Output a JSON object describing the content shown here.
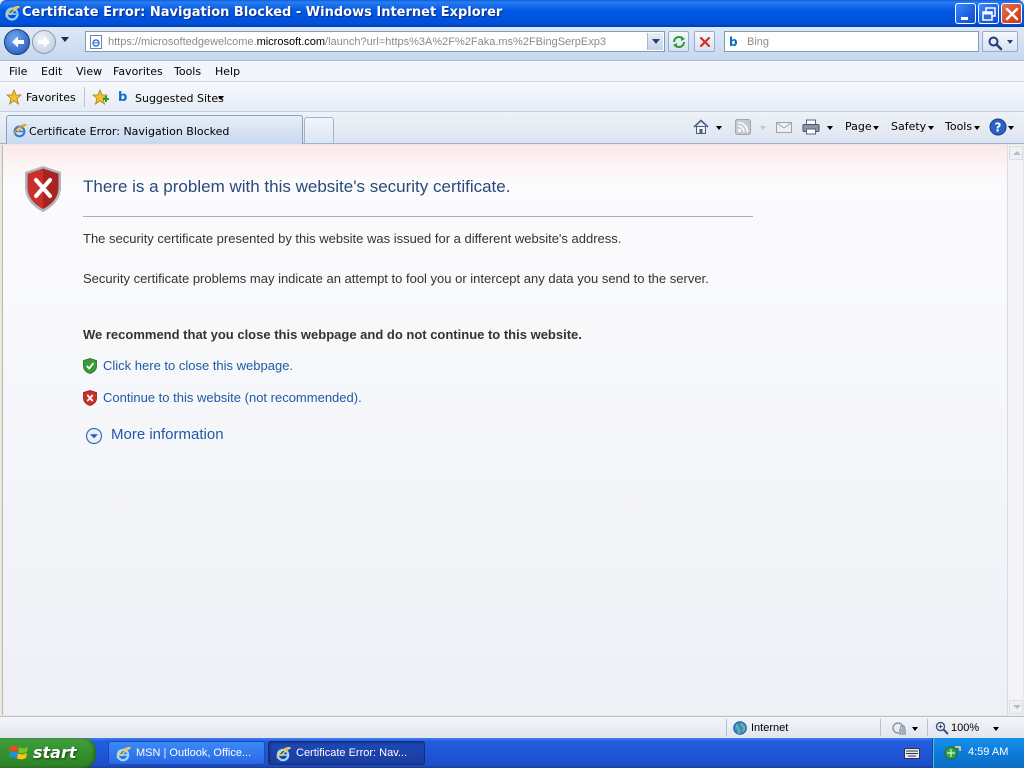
{
  "window": {
    "title": "Certificate Error: Navigation Blocked - Windows Internet Explorer"
  },
  "address_bar": {
    "url_prefix": "https://microsoftedgewelcome.",
    "url_domain": "microsoft.com",
    "url_suffix": "/launch?url=https%3A%2F%2Faka.ms%2FBingSerpExp3"
  },
  "search": {
    "placeholder": "Bing"
  },
  "menu": {
    "items": [
      "File",
      "Edit",
      "View",
      "Favorites",
      "Tools",
      "Help"
    ]
  },
  "favorites_bar": {
    "favorites_label": "Favorites",
    "suggested_sites_label": "Suggested Sites"
  },
  "tabs": [
    {
      "label": "Certificate Error: Navigation Blocked"
    }
  ],
  "command_bar": {
    "page_label": "Page",
    "safety_label": "Safety",
    "tools_label": "Tools"
  },
  "error_page": {
    "title": "There is a problem with this website's security certificate.",
    "paragraph1": "The security certificate presented by this website was issued for a different website's address.",
    "paragraph2": "Security certificate problems may indicate an attempt to fool you or intercept any data you send to the server.",
    "recommendation": "We recommend that you close this webpage and do not continue to this website.",
    "close_link": "Click here to close this webpage.",
    "continue_link": "Continue to this website (not recommended).",
    "more_info": "More information"
  },
  "status_bar": {
    "zone": "Internet",
    "zoom": "100%"
  },
  "taskbar": {
    "start_label": "start",
    "items": [
      {
        "label": "MSN | Outlook, Office...",
        "active": false
      },
      {
        "label": "Certificate Error: Nav...",
        "active": true
      }
    ],
    "clock": "4:59 AM"
  },
  "colors": {
    "link": "#1f5aa6",
    "title_text": "#2a4a7a",
    "shield_red": "#c9302c",
    "shield_green": "#3a9a3a"
  }
}
